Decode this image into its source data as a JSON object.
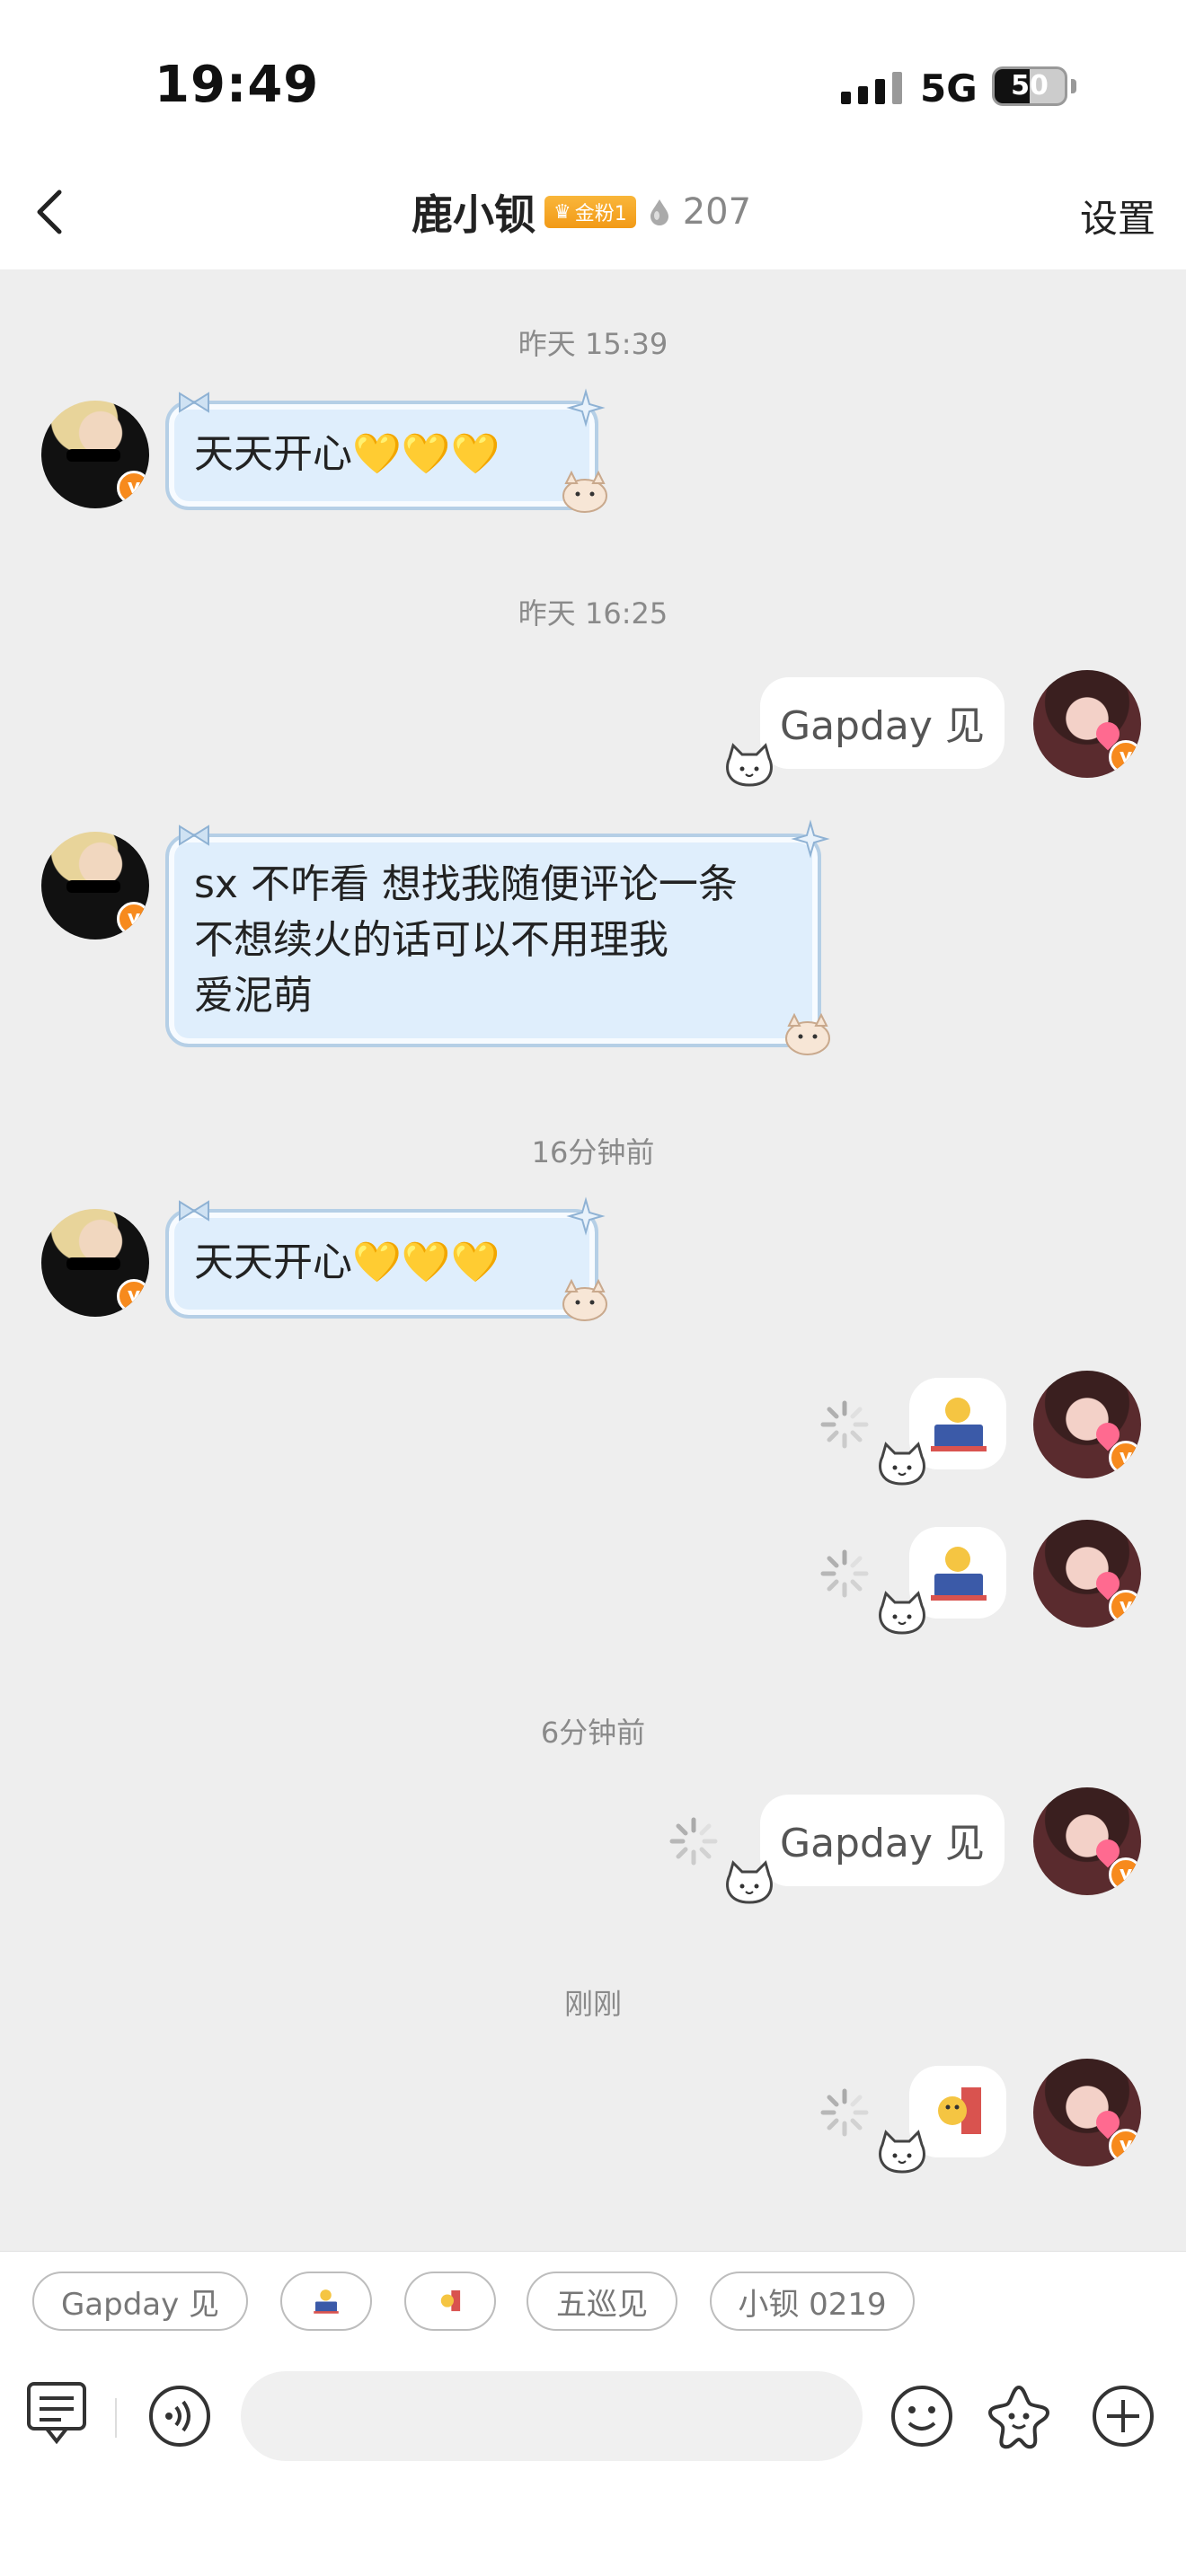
{
  "status_bar": {
    "time": "19:49",
    "network": "5G",
    "battery": "50",
    "battery_level": 0.5
  },
  "header": {
    "title": "鹿小钡",
    "badge": "金粉1",
    "fire_count": "207",
    "settings": "设置"
  },
  "timestamps": [
    "昨天 15:39",
    "昨天 16:25",
    "16分钟前",
    "6分钟前",
    "刚刚"
  ],
  "messages": [
    {
      "side": "left",
      "text": "天天开心💛💛💛"
    },
    {
      "side": "right",
      "text": "Gapday 见"
    },
    {
      "side": "left",
      "lines": [
        "sx 不咋看 想找我随便评论一条",
        "不想续火的话可以不用理我",
        "爱泥萌"
      ]
    },
    {
      "side": "left",
      "text": "天天开心💛💛💛"
    },
    {
      "side": "right",
      "type": "sticker",
      "status": "sending"
    },
    {
      "side": "right",
      "type": "sticker",
      "status": "sending"
    },
    {
      "side": "right",
      "text": "Gapday 见",
      "status": "sending"
    },
    {
      "side": "right",
      "type": "sticker",
      "status": "sending"
    }
  ],
  "quick_replies": [
    "Gapday 见",
    "sticker-1",
    "sticker-2",
    "五巡见",
    "小钡 0219"
  ],
  "input_bar": {
    "icons": [
      "chat-list-icon",
      "voice-icon",
      "emoji-icon",
      "sticker-star-icon",
      "plus-icon"
    ]
  }
}
